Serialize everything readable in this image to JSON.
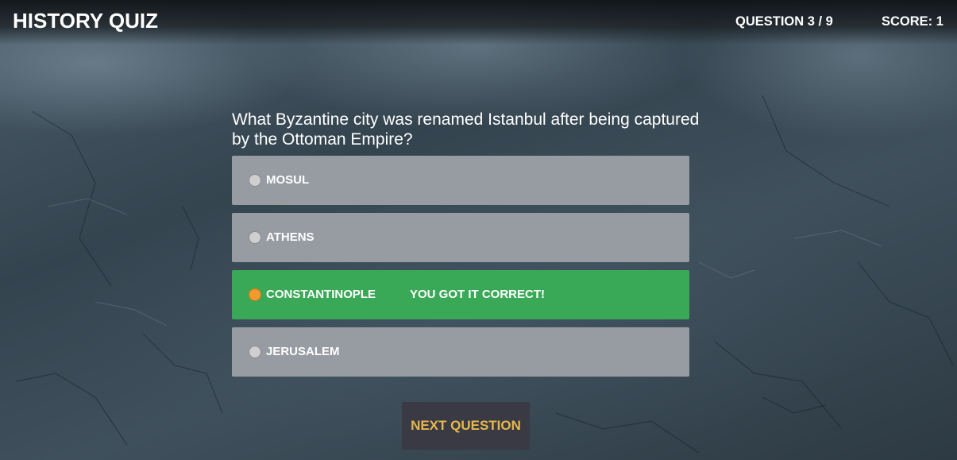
{
  "header": {
    "title": "HISTORY QUIZ",
    "progress": "QUESTION 3 / 9",
    "score": "SCORE: 1"
  },
  "quiz": {
    "question": "What Byzantine city was renamed Istanbul after being captured by the Ottoman Empire?",
    "answers": [
      {
        "label": "MOSUL",
        "selected": false,
        "state": "neutral"
      },
      {
        "label": "ATHENS",
        "selected": false,
        "state": "neutral"
      },
      {
        "label": "CONSTANTINOPLE",
        "selected": true,
        "state": "correct",
        "feedback": "YOU GOT IT CORRECT!"
      },
      {
        "label": "JERUSALEM",
        "selected": false,
        "state": "neutral"
      }
    ],
    "next_label": "NEXT QUESTION"
  },
  "colors": {
    "answer_neutral": "#979ca3",
    "answer_correct": "#3aa957",
    "radio_selected": "#f29a2e",
    "next_button_bg": "#3a3a44",
    "next_button_text": "#e6b84c"
  }
}
